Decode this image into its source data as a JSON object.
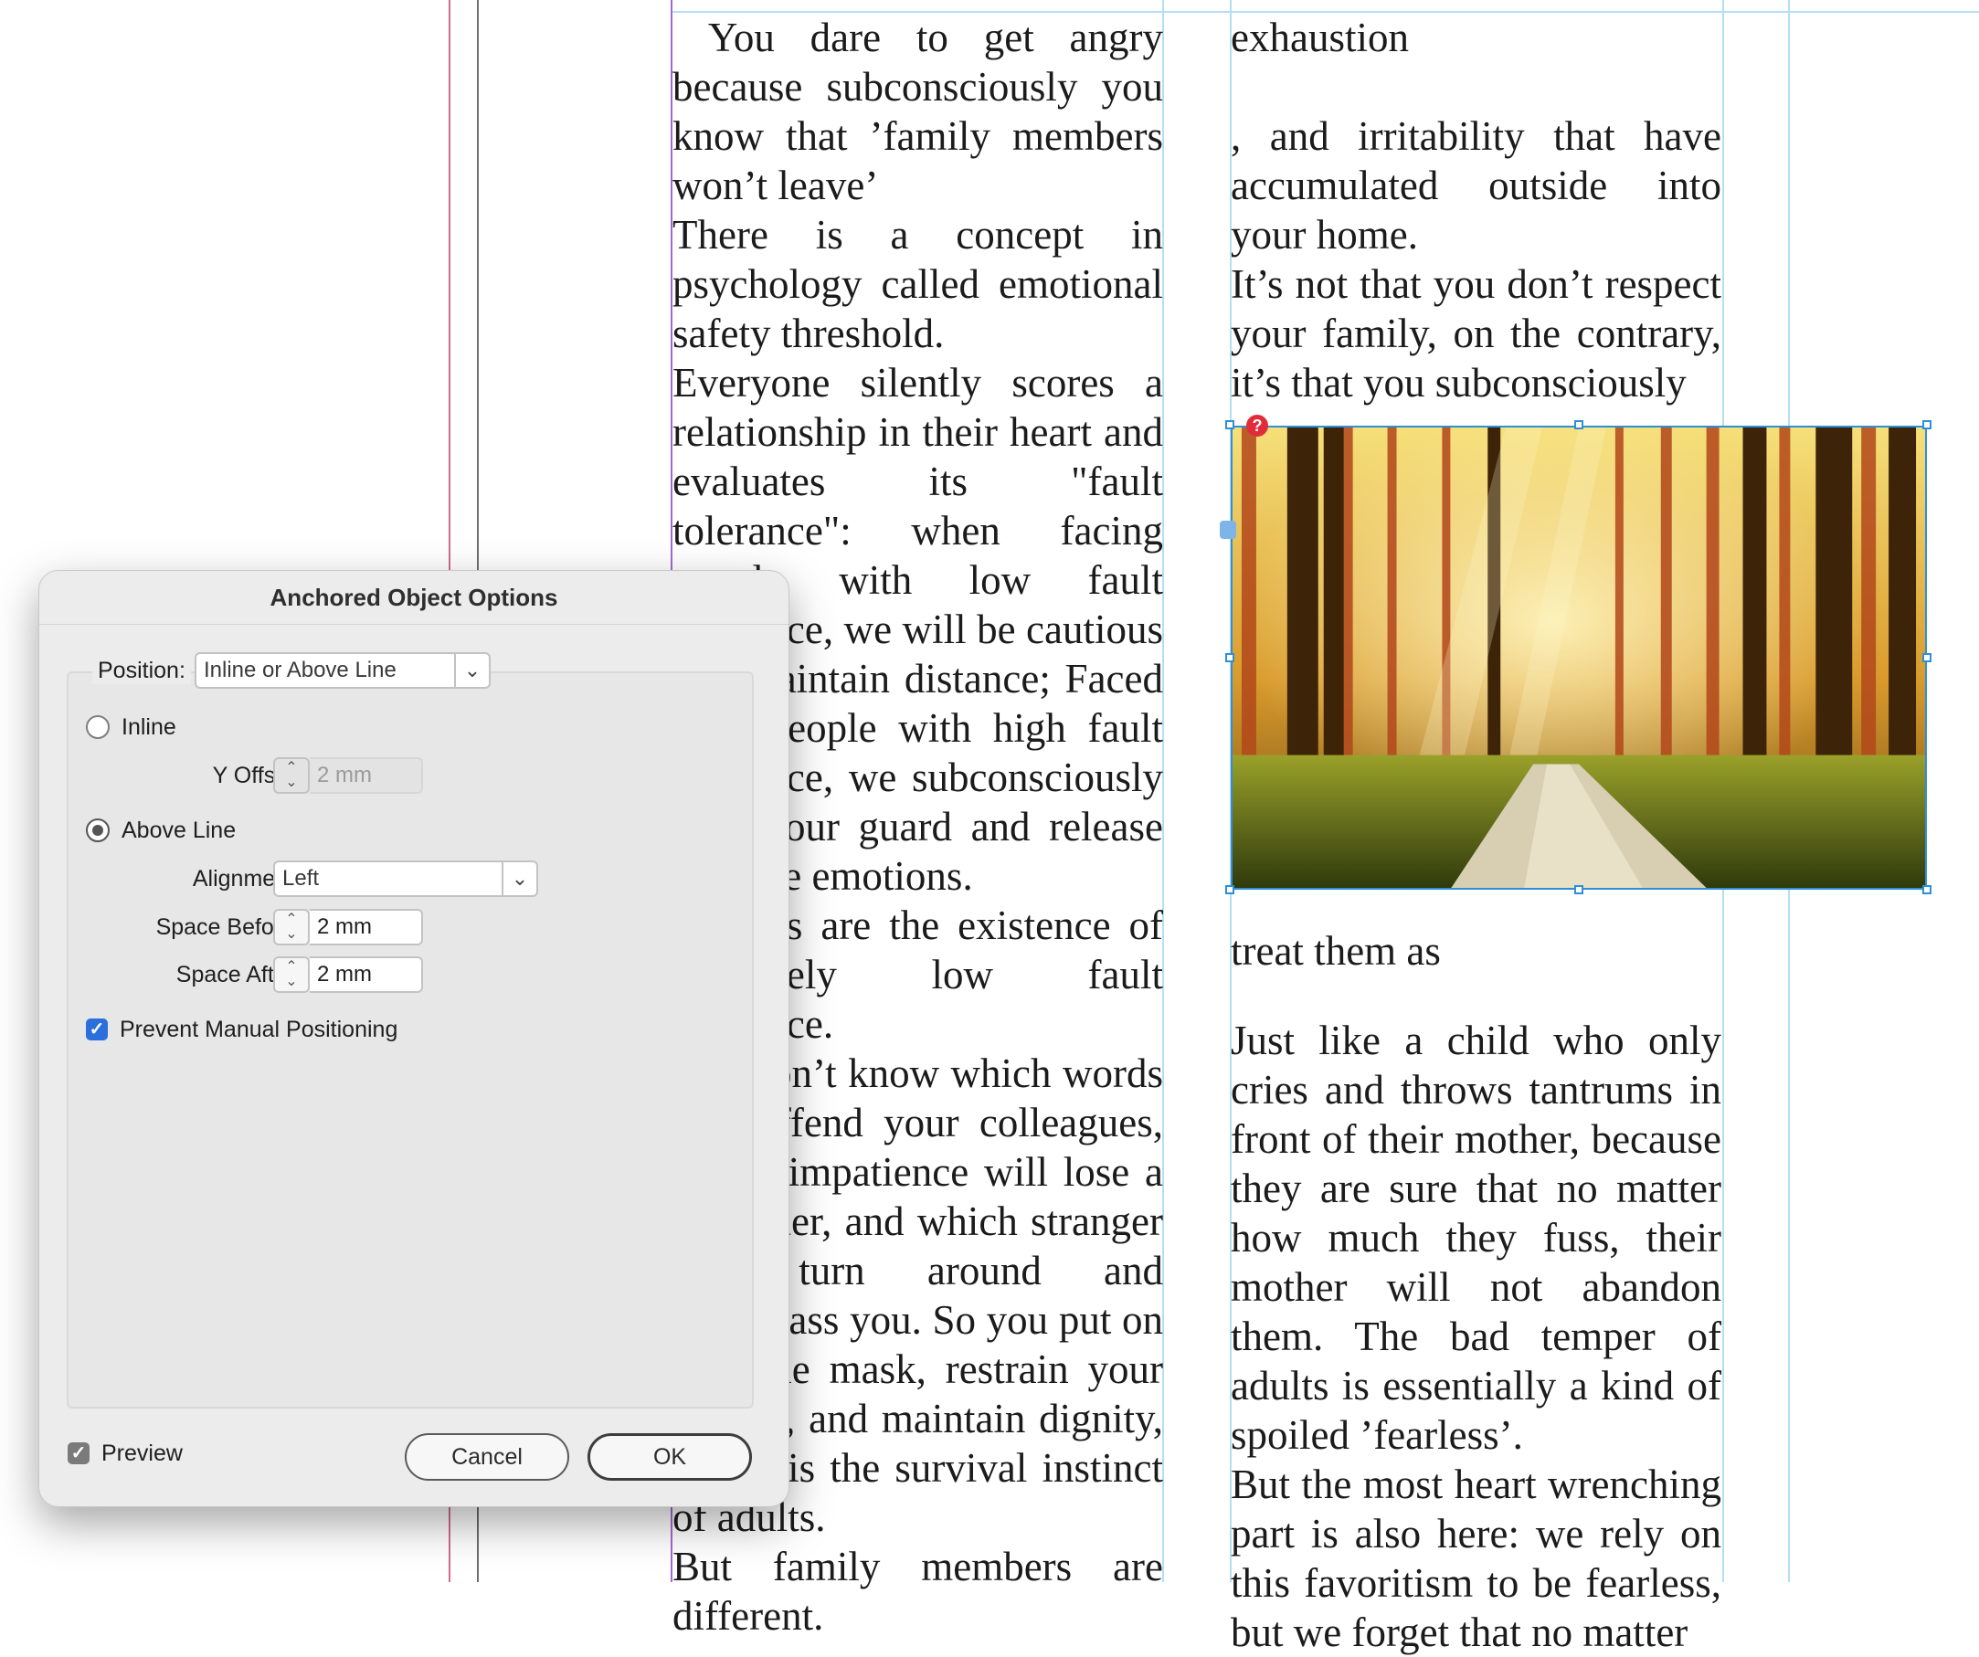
{
  "document": {
    "column1_paragraphs": [
      " You dare to get angry because subconsciously you know that ’family members won’t leave’",
      "There is a concept in psychology called emotional safety threshold.",
      "Everyone silently scores a relationship in their heart and evaluates its \"fault tolerance\": when facing people with low fault tolerance, we will be cautious and maintain distance; Faced with people with high fault tolerance, we subconsciously lower our guard and release our true emotions.",
      "Leaders are the existence of extremely low fault tolerance.",
      "You don’t know which words will offend your colleagues, which impatience will lose a customer, and which stranger will turn around and embarrass you. So you put on a gentle mask, restrain your temper, and maintain dignity, which is the survival instinct of adults.",
      "But family members are different."
    ],
    "column2_top": [
      "exhaustion",
      ", and irritability that have accumulated outside into your home.",
      "It’s not that you don’t respect your family, on the contrary, it’s that you subconsciously"
    ],
    "column2_after_image": "treat them as",
    "column2_bottom": [
      "Just like a child who only cries and throws tantrums in front of their mother, because they are sure that no matter how much they fuss, their mother will not abandon them. The bad temper of adults is essentially a kind of spoiled ’fearless’.",
      "But the most heart wrenching part is also here: we rely on this favoritism to be fearless, but we forget that no matter"
    ],
    "image_warning_glyph": "?"
  },
  "dialog": {
    "title": "Anchored Object Options",
    "position_label": "Position:",
    "position_value": "Inline or Above Line",
    "inline_label": "Inline",
    "y_offset_label": "Y Offset:",
    "y_offset_value": "2 mm",
    "above_line_label": "Above Line",
    "alignment_label": "Alignment:",
    "alignment_value": "Left",
    "space_before_label": "Space Before:",
    "space_before_value": "2 mm",
    "space_after_label": "Space After:",
    "space_after_value": "2 mm",
    "prevent_manual_label": "Prevent Manual Positioning",
    "preview_label": "Preview",
    "cancel_label": "Cancel",
    "ok_label": "OK",
    "inline_selected": false,
    "above_line_selected": true,
    "prevent_manual_checked": true,
    "preview_checked": true
  },
  "icons": {
    "dropdown": "chevron-down-icon",
    "stepper": "stepper-icon",
    "checkmark": "checkmark-icon",
    "warning": "missing-link-icon",
    "anchor": "anchor-marker-icon"
  },
  "colors": {
    "frame_selection": "#2f8fd6",
    "checkbox_blue": "#2a6fdb",
    "warning_red": "#e22c3a",
    "margin_guide": "#b4dff0"
  }
}
